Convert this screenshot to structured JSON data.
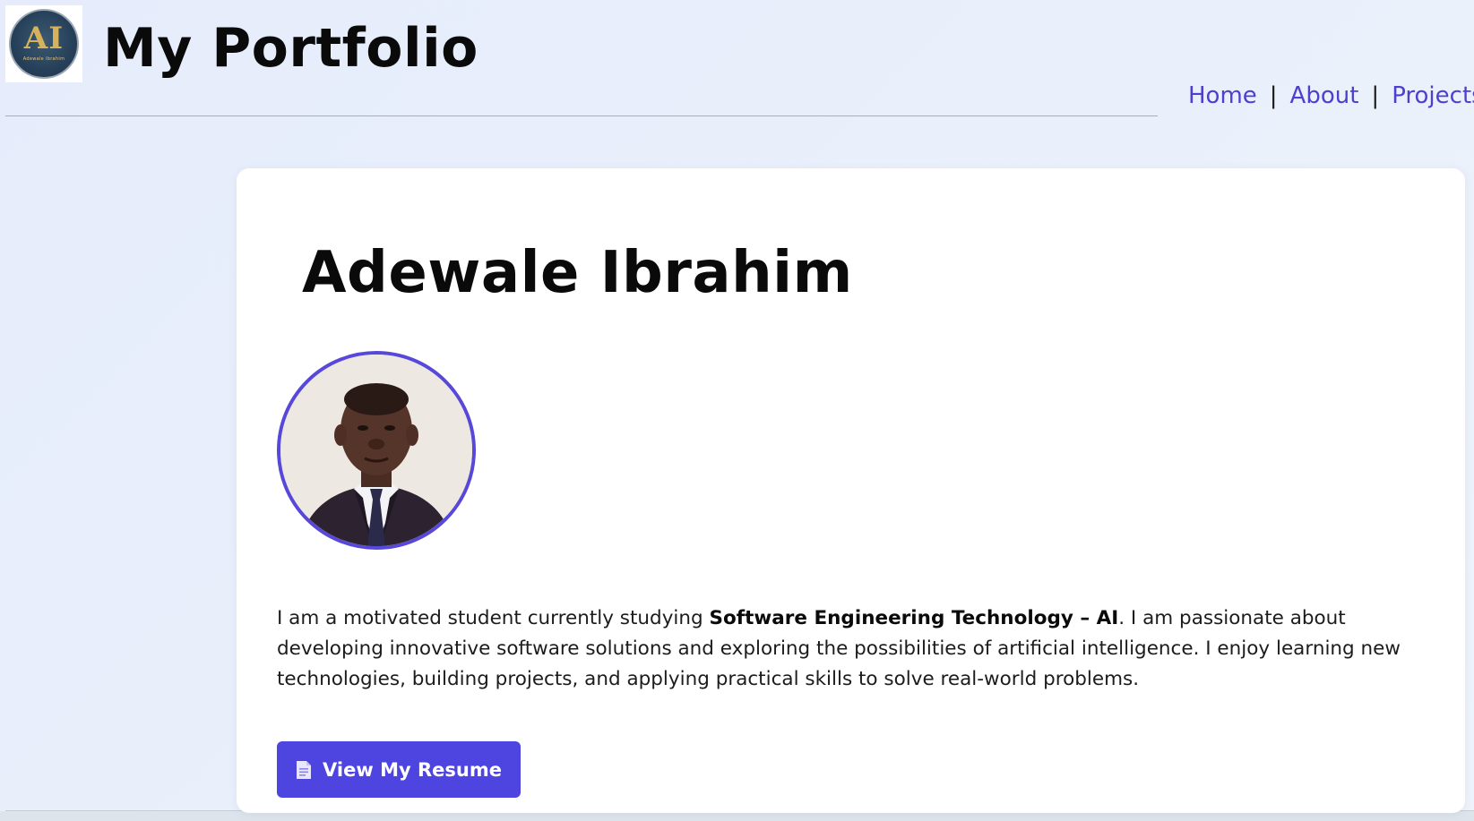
{
  "header": {
    "logo_text": "AI",
    "logo_subtext": "Adewale Ibrahim",
    "site_title": "My Portfolio"
  },
  "nav": {
    "items": [
      {
        "label": "Home"
      },
      {
        "label": "About"
      },
      {
        "label": "Projects"
      }
    ],
    "separator": "|"
  },
  "profile": {
    "name": "Adewale Ibrahim",
    "bio_part1": "I am a motivated student currently studying ",
    "bio_program": "Software Engineering Technology – AI",
    "bio_part2": ". I am passionate about developing innovative software solutions and exploring the possibilities of artificial intelligence. I enjoy learning new technologies, building projects, and applying practical skills to solve real-world problems.",
    "resume_button_label": "View My Resume",
    "avatar_alt": "Profile photo"
  },
  "colors": {
    "accent": "#4e44e0",
    "nav_link": "#4f3fcf",
    "card_bg": "#ffffff",
    "page_bg": "#e8eefb"
  },
  "icons": {
    "resume_button_icon": "document-icon",
    "logo": "logo-icon"
  }
}
